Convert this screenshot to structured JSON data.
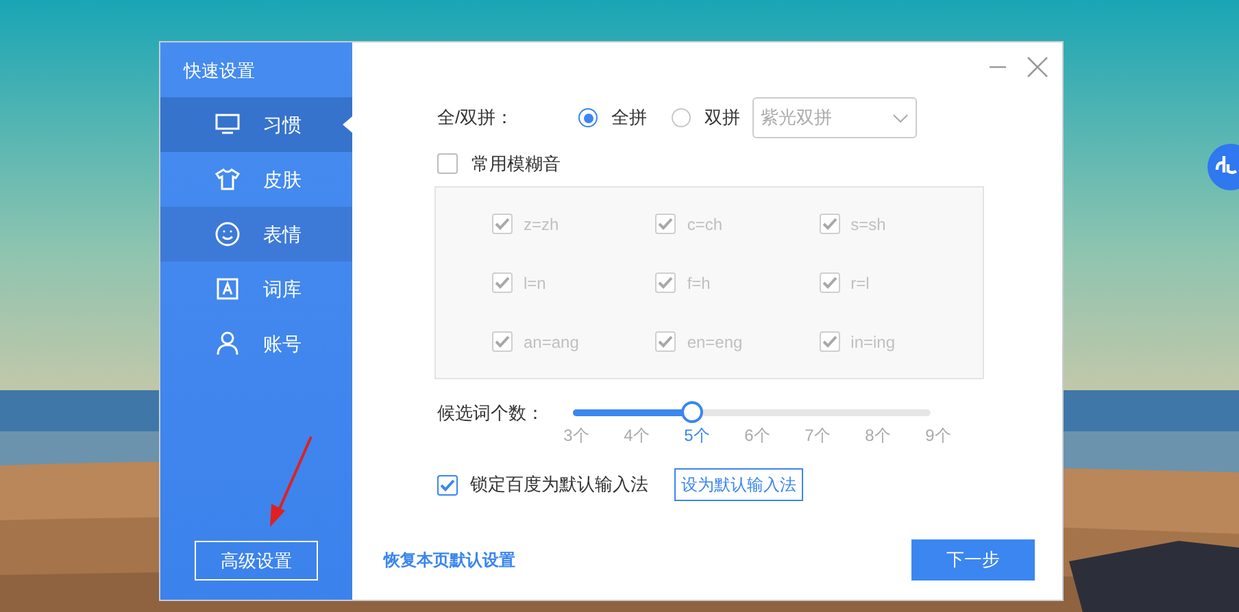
{
  "sidebar": {
    "title": "快速设置",
    "items": [
      {
        "label": "习惯",
        "kind": "monitor",
        "selected": true,
        "hovered": false
      },
      {
        "label": "皮肤",
        "kind": "shirt",
        "selected": false,
        "hovered": false
      },
      {
        "label": "表情",
        "kind": "smile",
        "selected": false,
        "hovered": true
      },
      {
        "label": "词库",
        "kind": "letter",
        "selected": false,
        "hovered": false
      },
      {
        "label": "账号",
        "kind": "user",
        "selected": false,
        "hovered": false
      }
    ],
    "advanced_button": "高级设置"
  },
  "pinyin": {
    "label": "全/双拼：",
    "options": [
      {
        "label": "全拼",
        "selected": true
      },
      {
        "label": "双拼",
        "selected": false
      }
    ],
    "scheme_select": {
      "value": "紫光双拼",
      "disabled": true
    }
  },
  "fuzzy": {
    "label": "常用模糊音",
    "checked": false,
    "pairs": [
      {
        "label": "z=zh",
        "checked": true
      },
      {
        "label": "c=ch",
        "checked": true
      },
      {
        "label": "s=sh",
        "checked": true
      },
      {
        "label": "l=n",
        "checked": true
      },
      {
        "label": "f=h",
        "checked": true
      },
      {
        "label": "r=l",
        "checked": true
      },
      {
        "label": "an=ang",
        "checked": true
      },
      {
        "label": "en=eng",
        "checked": true
      },
      {
        "label": "in=ing",
        "checked": true
      }
    ]
  },
  "candidates": {
    "label": "候选词个数：",
    "level": 0.333,
    "ticks": [
      {
        "label": "3个",
        "selected": false
      },
      {
        "label": "4个",
        "selected": false
      },
      {
        "label": "5个",
        "selected": true
      },
      {
        "label": "6个",
        "selected": false
      },
      {
        "label": "7个",
        "selected": false
      },
      {
        "label": "8个",
        "selected": false
      },
      {
        "label": "9个",
        "selected": false
      }
    ]
  },
  "lock_default": {
    "label": "锁定百度为默认输入法",
    "checked": true
  },
  "set_default_button": "设为默认输入法",
  "restore_link": "恢复本页默认设置",
  "next_button": "下一步"
}
